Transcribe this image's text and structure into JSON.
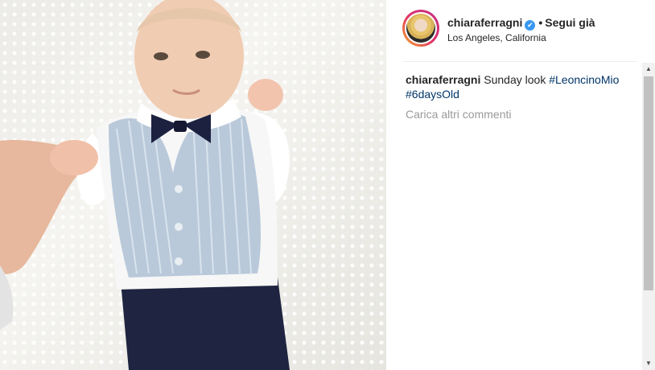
{
  "post": {
    "username": "chiaraferragni",
    "follow_separator": "•",
    "follow_label": "Segui già",
    "location": "Los Angeles, California",
    "verified_icon": "✔"
  },
  "caption": {
    "username": "chiaraferragni",
    "text": "Sunday look",
    "hashtags": [
      "#LeoncinoMio",
      "#6daysOld"
    ]
  },
  "load_more_label": "Carica altri commenti",
  "scrollbar": {
    "up_icon": "▲",
    "down_icon": "▼"
  }
}
